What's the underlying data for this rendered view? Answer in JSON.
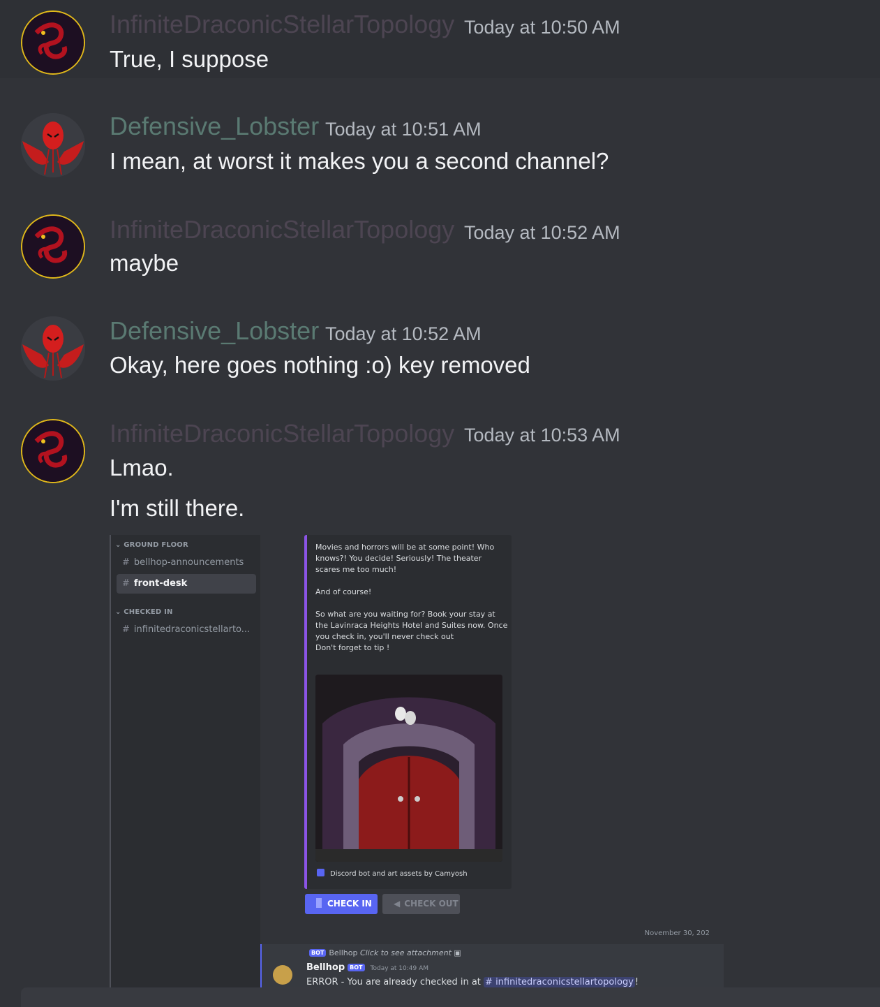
{
  "messages": [
    {
      "author": "InfiniteDraconicStellarTopology",
      "timestamp": "Today at 10:50 AM",
      "lines": [
        "True, I suppose"
      ]
    },
    {
      "author": "Defensive_Lobster",
      "timestamp": "Today at 10:51 AM",
      "lines": [
        "I mean, at worst it makes you a second channel?"
      ]
    },
    {
      "author": "InfiniteDraconicStellarTopology",
      "timestamp": "Today at 10:52 AM",
      "lines": [
        "maybe"
      ]
    },
    {
      "author": "Defensive_Lobster",
      "timestamp": "Today at 10:52 AM",
      "lines": [
        "Okay, here goes nothing :o) key removed"
      ]
    },
    {
      "author": "InfiniteDraconicStellarTopology",
      "timestamp": "Today at 10:53 AM",
      "lines": [
        "Lmao.",
        "I'm still there."
      ]
    }
  ],
  "attachment": {
    "sidebar": {
      "ground_floor_label": "GROUND FLOOR",
      "checked_in_label": "CHECKED IN",
      "channels": [
        "bellhop-announcements",
        "front-desk",
        "infinitedraconicstellarto..."
      ]
    },
    "embed": {
      "para1": "Movies and horrors will be at some point! Who knows?! You decide! Seriously! The theater scares me too much!",
      "para2": "And of course!",
      "para3": "So what are you waiting for? Book your stay at the Lavinraca Heights Hotel and Suites now. Once you check in, you'll never check out",
      "para4": "Don't forget to tip !",
      "footer": "Discord bot and art assets by Camyosh"
    },
    "buttons": {
      "check_in": "CHECK IN",
      "check_out": "CHECK OUT"
    },
    "date_divider": "November 30, 202",
    "bot_message": {
      "reply_badge": "BOT",
      "reply_author": "Bellhop",
      "reply_text": "Click to see attachment",
      "author": "Bellhop",
      "badge": "BOT",
      "timestamp": "Today at 10:49 AM",
      "text_prefix": "ERROR - You are already checked in at",
      "mention": "# infinitedraconicstellartopology",
      "text_suffix": "!"
    }
  }
}
